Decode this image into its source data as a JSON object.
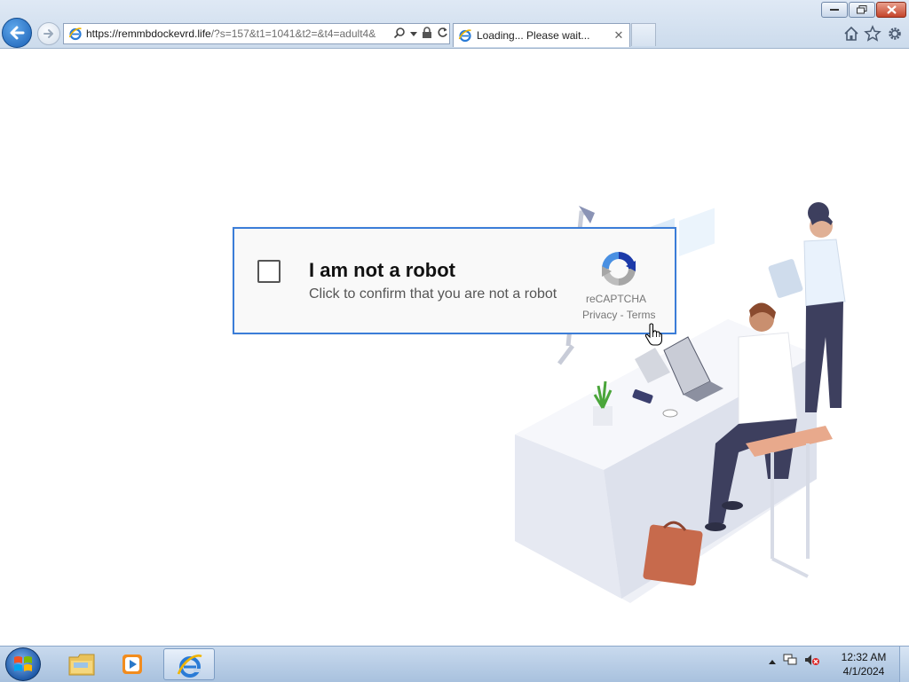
{
  "browser": {
    "url_host": "https://remmbdockevrd.life",
    "url_query": "/?s=157&t1=1041&t2=&t4=adult4&",
    "tab_title": "Loading... Please wait...",
    "tab_close": "✕"
  },
  "captcha": {
    "title": "I am not a robot",
    "subtitle": "Click to confirm that you are not a robot",
    "brand": "reCAPTCHA",
    "links": "Privacy - Terms",
    "checked": false,
    "accent_color": "#3b7dd8"
  },
  "taskbar": {
    "time": "12:32 AM",
    "date": "4/1/2024",
    "apps": [
      "file-explorer",
      "windows-media-player",
      "internet-explorer"
    ]
  },
  "icons": [
    "back-arrow-icon",
    "forward-arrow-icon",
    "search-icon",
    "lock-icon",
    "refresh-icon",
    "home-icon",
    "star-icon",
    "gear-icon",
    "recaptcha-logo",
    "hand-cursor-icon",
    "windows-start-icon"
  ]
}
